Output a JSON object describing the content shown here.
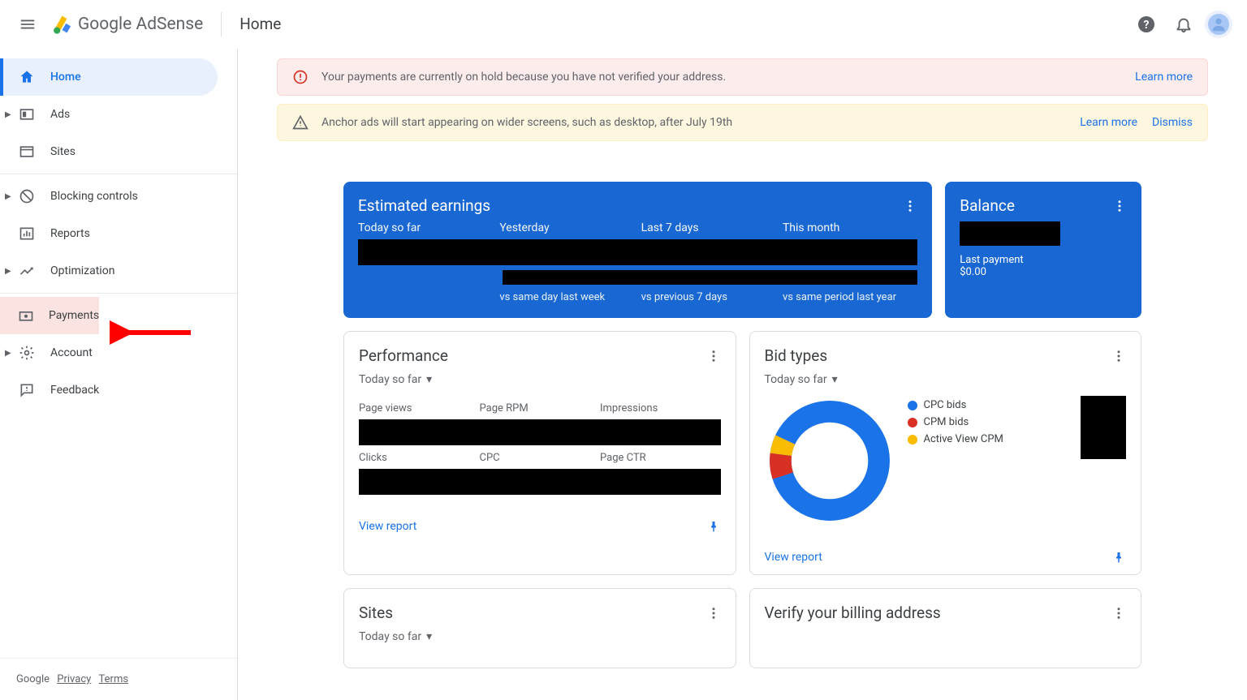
{
  "header": {
    "product": "Google",
    "product2": "AdSense",
    "page": "Home"
  },
  "sidebar": {
    "items": [
      {
        "label": "Home"
      },
      {
        "label": "Ads"
      },
      {
        "label": "Sites"
      },
      {
        "label": "Blocking controls"
      },
      {
        "label": "Reports"
      },
      {
        "label": "Optimization"
      },
      {
        "label": "Payments"
      },
      {
        "label": "Account"
      },
      {
        "label": "Feedback"
      }
    ],
    "footer": {
      "brand": "Google",
      "privacy": "Privacy",
      "terms": "Terms"
    }
  },
  "alerts": {
    "err": {
      "msg": "Your payments are currently on hold because you have not verified your address.",
      "learn": "Learn more"
    },
    "warn": {
      "msg": "Anchor ads will start appearing on wider screens, such as desktop, after July 19th",
      "learn": "Learn more",
      "dismiss": "Dismiss"
    }
  },
  "earnings": {
    "title": "Estimated earnings",
    "cols": [
      {
        "label": "Today so far",
        "sub": ""
      },
      {
        "label": "Yesterday",
        "sub": "vs same day last week"
      },
      {
        "label": "Last 7 days",
        "sub": "vs previous 7 days"
      },
      {
        "label": "This month",
        "sub": "vs same period last year"
      }
    ]
  },
  "balance": {
    "title": "Balance",
    "last_label": "Last payment",
    "amount": "$0.00"
  },
  "performance": {
    "title": "Performance",
    "range": "Today so far",
    "metrics": [
      "Page views",
      "Page RPM",
      "Impressions",
      "Clicks",
      "CPC",
      "Page CTR"
    ],
    "view": "View report"
  },
  "bids": {
    "title": "Bid types",
    "range": "Today so far",
    "legend": [
      {
        "name": "CPC bids",
        "color": "#1a73e8"
      },
      {
        "name": "CPM bids",
        "color": "#d93025"
      },
      {
        "name": "Active View CPM",
        "color": "#fbbc04"
      }
    ],
    "view": "View report"
  },
  "sites": {
    "title": "Sites",
    "range": "Today so far"
  },
  "verify": {
    "title": "Verify your billing address"
  },
  "chart_data": {
    "type": "pie",
    "title": "Bid types",
    "series": [
      {
        "name": "CPC bids",
        "value": 88,
        "color": "#1a73e8"
      },
      {
        "name": "CPM bids",
        "value": 7,
        "color": "#d93025"
      },
      {
        "name": "Active View CPM",
        "value": 5,
        "color": "#fbbc04"
      }
    ]
  }
}
